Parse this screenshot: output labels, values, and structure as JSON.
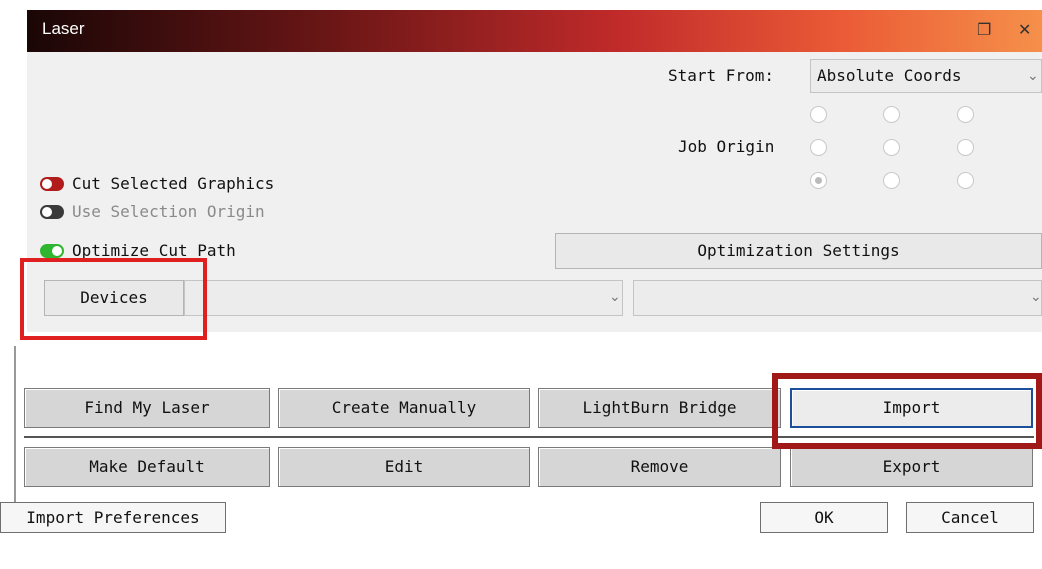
{
  "laser_panel": {
    "title": "Laser",
    "start_from_label": "Start From:",
    "start_from_value": "Absolute Coords",
    "job_origin_label": "Job Origin",
    "job_origin_selected": "bottom-left",
    "options": [
      {
        "label": "Cut Selected Graphics",
        "state": "on",
        "color": "#b01c1c",
        "dim": false
      },
      {
        "label": "Use Selection Origin",
        "state": "off",
        "color": "#3a3a3a",
        "dim": true
      },
      {
        "label": "Optimize Cut Path",
        "state": "on",
        "color": "#2fb52f",
        "dim": false
      }
    ],
    "optimization_settings_label": "Optimization Settings",
    "devices_label": "Devices",
    "device_select_value": "",
    "port_select_value": ""
  },
  "device_dialog": {
    "row1": [
      "Find My Laser",
      "Create Manually",
      "LightBurn Bridge",
      "Import"
    ],
    "row2": [
      "Make Default",
      "Edit",
      "Remove",
      "Export"
    ],
    "import_preferences_label": "Import Preferences",
    "ok_label": "OK",
    "cancel_label": "Cancel"
  },
  "colors": {
    "highlight": "#e02020",
    "highlight_dark": "#a01818",
    "primary_border": "#1b4f9c"
  },
  "icons": [
    "restore-icon",
    "close-icon",
    "chevron-down-icon",
    "radio-button",
    "toggle-switch"
  ]
}
